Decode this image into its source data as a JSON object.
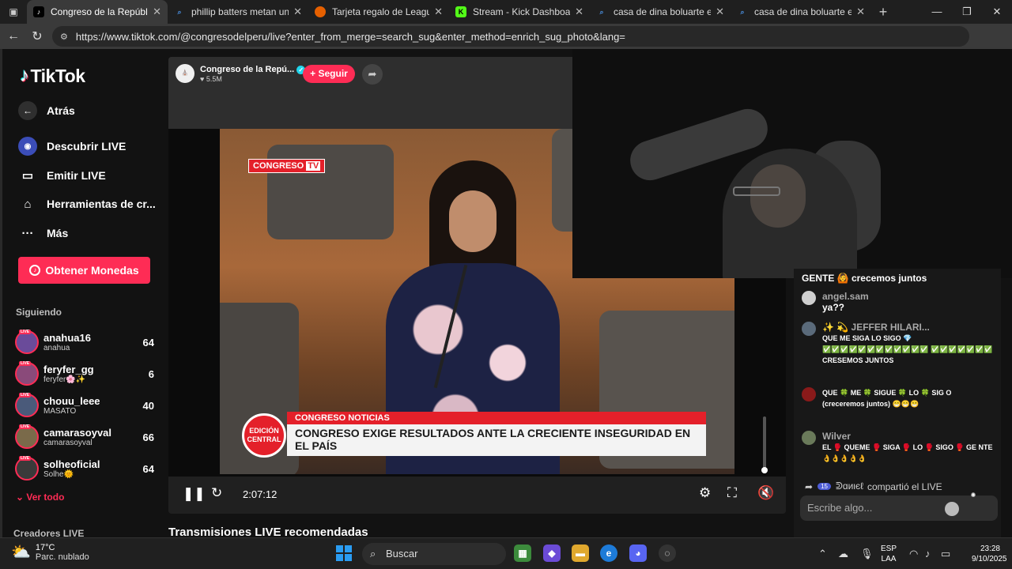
{
  "browser": {
    "tabs": [
      {
        "title": "Congreso de la República (@",
        "active": true,
        "favicon": "tiktok-icon"
      },
      {
        "title": "phillip batters metan un bal",
        "active": false,
        "favicon": "search-icon"
      },
      {
        "title": "Tarjeta regalo de League of L",
        "active": false,
        "favicon": "firefox-icon"
      },
      {
        "title": "Stream - Kick Dashboard",
        "active": false,
        "favicon": "kick-icon"
      },
      {
        "title": "casa de dina boluarte en vivo",
        "active": false,
        "favicon": "search-icon"
      },
      {
        "title": "casa de dina boluarte en vivo",
        "active": false,
        "favicon": "search-icon"
      }
    ],
    "url": "https://www.tiktok.com/@congresodelperu/live?enter_from_merge=search_sug&enter_method=enrich_sug_photo&lang="
  },
  "sidebar": {
    "brand": "TikTok",
    "back_label": "Atrás",
    "nav": [
      {
        "label": "Descubrir LIVE",
        "icon": "live-discover-icon"
      },
      {
        "label": "Emitir LIVE",
        "icon": "video-camera-icon"
      },
      {
        "label": "Herramientas de cr...",
        "icon": "creator-tools-icon"
      },
      {
        "label": "Más",
        "icon": "more-dots-icon"
      }
    ],
    "coins_button": "Obtener Monedas",
    "following_title": "Siguiendo",
    "following": [
      {
        "name": "anahua16",
        "sub": "anahua",
        "count": "64"
      },
      {
        "name": "feryfer_gg",
        "sub": "feryfer🌸✨",
        "count": "6"
      },
      {
        "name": "chouu_leee",
        "sub": "MASATO",
        "count": "40"
      },
      {
        "name": "camarasoyval",
        "sub": "camarasoyval",
        "count": "66"
      },
      {
        "name": "solheoficial",
        "sub": "Solhe🌞",
        "count": "64"
      }
    ],
    "see_all": "Ver todo",
    "creators_title": "Creadores LIVE"
  },
  "player": {
    "host_name": "Congreso de la Repú...",
    "host_likes": "5.5M",
    "follow_label": "+ Seguir",
    "time": "2:07:12",
    "volume_level": 0.05,
    "overlay": {
      "channel_logo": "CONGRESO",
      "channel_logo_tv": "TV",
      "edition": "EDICIÓN CENTRAL",
      "tag": "CONGRESO NOTICIAS",
      "headline": "CONGRESO EXIGE RESULTADOS ANTE LA CRECIENTE INSEGURIDAD EN EL PAÍS"
    }
  },
  "recommended_title": "Transmisiones LIVE recomendadas",
  "chat": {
    "messages": [
      {
        "user": "",
        "text": "GENTE 🙆 crecemos juntos"
      },
      {
        "user": "angel.sam",
        "text": "ya??"
      },
      {
        "user": "✨ 💫 JEFFER HILARI...",
        "text": "QUE ME SIGA LO SIGO 💎 ✅✅✅✅✅✅✅✅✅✅✅✅ ✅✅✅✅✅✅✅ CRESEMOS JUNTOS"
      },
      {
        "user": "",
        "text": "QUE 🍀 ME 🍀 SIGUE 🍀 LO 🍀 SIG O (creceremos juntos) 😁😁😁"
      },
      {
        "user": "Wilver",
        "text": "EL 🥊 QUEME 🥊 SIGA 🥊 LO 🥊 SIGO 🥊 GE NTE 👌👌👌👌👌"
      }
    ],
    "share_badge": "15",
    "share_user": "ᕲɑиιєℓ",
    "share_text": "compartió el LIVE",
    "input_placeholder": "Escribe algo..."
  },
  "taskbar": {
    "weather_temp": "17°C",
    "weather_desc": "Parc. nublado",
    "search_label": "Buscar",
    "lang_line1": "ESP",
    "lang_line2": "LAA",
    "time": "23:28",
    "date": "9/10/2025"
  }
}
